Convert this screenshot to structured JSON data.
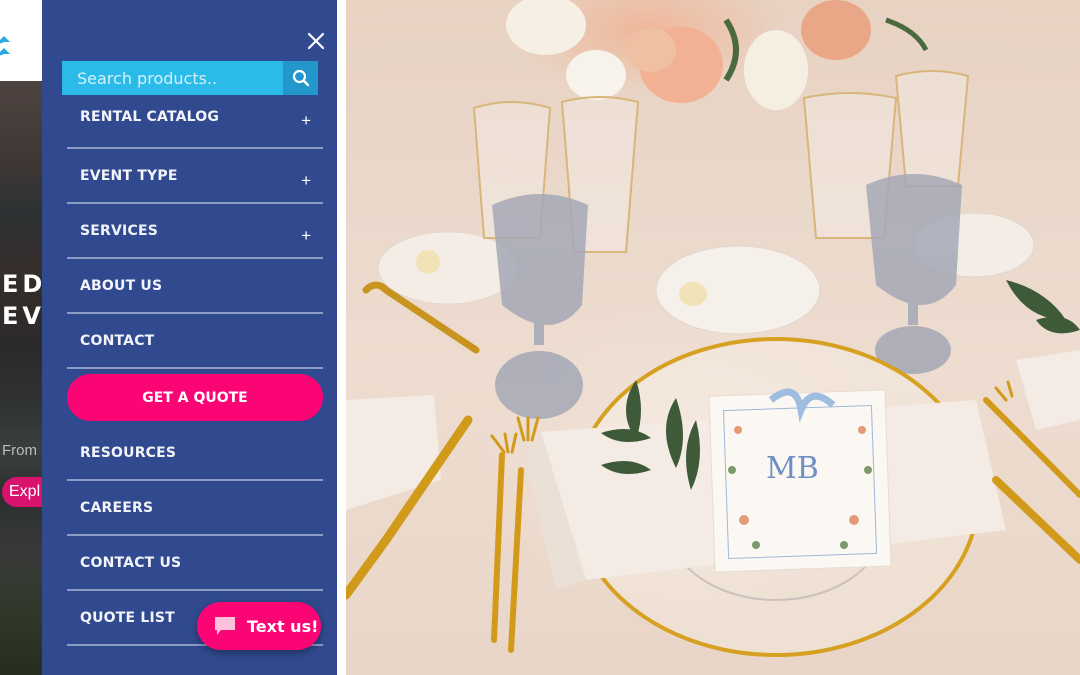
{
  "background_page": {
    "hero_text_line1": "ED",
    "hero_text_line2": "EV",
    "subtext_fragment": "From",
    "cta_fragment": "Expl"
  },
  "menu": {
    "close_icon": "close-icon",
    "search": {
      "placeholder": "Search products..",
      "value": "",
      "button_icon": "search-icon"
    },
    "items": [
      {
        "label": "RENTAL CATALOG",
        "expandable": true,
        "icon": "plus-icon"
      },
      {
        "label": "EVENT TYPE",
        "expandable": true,
        "icon": "plus-icon"
      },
      {
        "label": "SERVICES",
        "expandable": true,
        "icon": "plus-icon"
      },
      {
        "label": "ABOUT US",
        "expandable": false
      },
      {
        "label": "CONTACT",
        "expandable": false
      }
    ],
    "quote_button": {
      "label": "GET A QUOTE"
    },
    "items_after": [
      {
        "label": "RESOURCES"
      },
      {
        "label": "CAREERS"
      },
      {
        "label": "CONTACT US"
      },
      {
        "label": "QUOTE LIST"
      }
    ],
    "expand_symbol": "+"
  },
  "chat_widget": {
    "label": "Text us!",
    "icon": "chat-bubble-icon"
  },
  "photo": {
    "description": "Wedding table setting with gold-rimmed glass charger plate, floral menu card with blue ribbon, gold cutlery and glassware"
  },
  "colors": {
    "panel_bg": "#314a8f",
    "search_bg": "#2abbe8",
    "search_button_bg": "#2297cc",
    "accent_pink": "#fb0575",
    "divider": "#8e9cc4"
  }
}
